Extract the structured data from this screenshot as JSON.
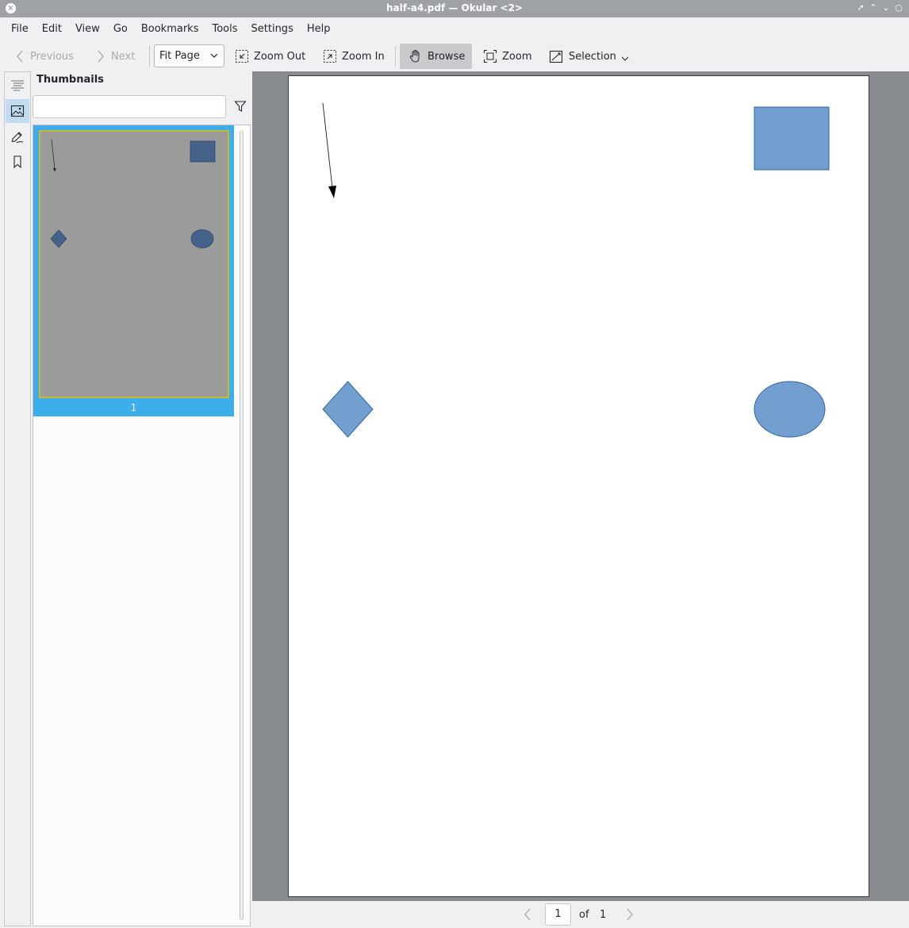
{
  "window": {
    "title": "half-a4.pdf — Okular <2>",
    "close_glyph": "×",
    "buttons": [
      "✕",
      "▴",
      "▾",
      "×"
    ]
  },
  "menubar": {
    "items": [
      "File",
      "Edit",
      "View",
      "Go",
      "Bookmarks",
      "Tools",
      "Settings",
      "Help"
    ]
  },
  "toolbar": {
    "previous_label": "Previous",
    "next_label": "Next",
    "zoom_mode": "Fit Page",
    "zoom_out_label": "Zoom Out",
    "zoom_in_label": "Zoom In",
    "browse_label": "Browse",
    "zoom_label": "Zoom",
    "selection_label": "Selection"
  },
  "sidebar": {
    "panel_title": "Thumbnails",
    "filter_placeholder": "",
    "thumbnail_page_label": "1",
    "icons": [
      "contents-icon",
      "thumbnails-icon",
      "annotations-icon",
      "bookmarks-icon"
    ]
  },
  "document": {
    "shapes": [
      "arrow",
      "rectangle",
      "diamond",
      "ellipse"
    ],
    "shape_fill": "#729fcf",
    "shape_stroke": "#3465a4"
  },
  "pagenav": {
    "current_page": "1",
    "of_label": "of",
    "total_pages": "1"
  },
  "colors": {
    "accent": "#3daee9",
    "titlebar": "#9ea2a6",
    "viewer_background": "#888c90"
  }
}
